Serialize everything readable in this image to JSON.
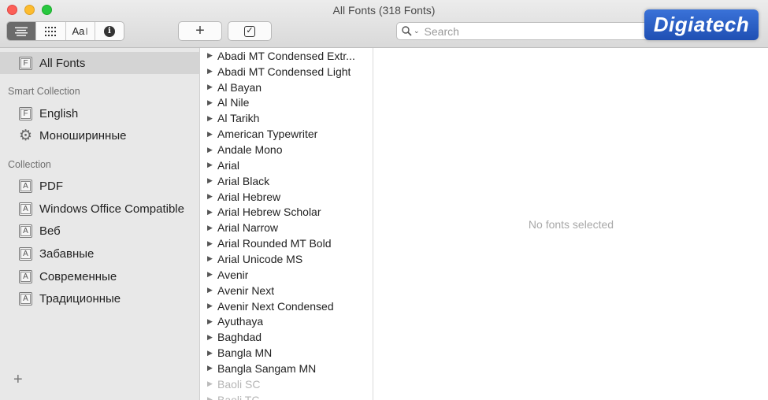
{
  "window": {
    "title": "All Fonts (318 Fonts)"
  },
  "toolbar": {
    "aa_label": "Aa",
    "add_label": "+",
    "check_label": "✓",
    "search_placeholder": "Search"
  },
  "logo": {
    "text": "Digiatech"
  },
  "sidebar": {
    "all_fonts": "All Fonts",
    "smart_header": "Smart Collection",
    "smart_items": [
      {
        "label": "English",
        "icon": "font-book-icon"
      },
      {
        "label": "Моноширинные",
        "icon": "gear-icon"
      }
    ],
    "collection_header": "Collection",
    "collection_items": [
      {
        "label": "PDF"
      },
      {
        "label": "Windows Office Compatible"
      },
      {
        "label": "Веб"
      },
      {
        "label": "Забавные"
      },
      {
        "label": "Современные"
      },
      {
        "label": "Традиционные"
      }
    ],
    "add_label": "+"
  },
  "fonts": [
    "Abadi MT Condensed Extr...",
    "Abadi MT Condensed Light",
    "Al Bayan",
    "Al Nile",
    "Al Tarikh",
    "American Typewriter",
    "Andale Mono",
    "Arial",
    "Arial Black",
    "Arial Hebrew",
    "Arial Hebrew Scholar",
    "Arial Narrow",
    "Arial Rounded MT Bold",
    "Arial Unicode MS",
    "Avenir",
    "Avenir Next",
    "Avenir Next Condensed",
    "Ayuthaya",
    "Baghdad",
    "Bangla MN",
    "Bangla Sangam MN",
    "Baoli SC",
    "Baoli TC"
  ],
  "dim_fonts": [
    "Baoli SC",
    "Baoli TC"
  ],
  "preview": {
    "empty_text": "No fonts selected"
  }
}
